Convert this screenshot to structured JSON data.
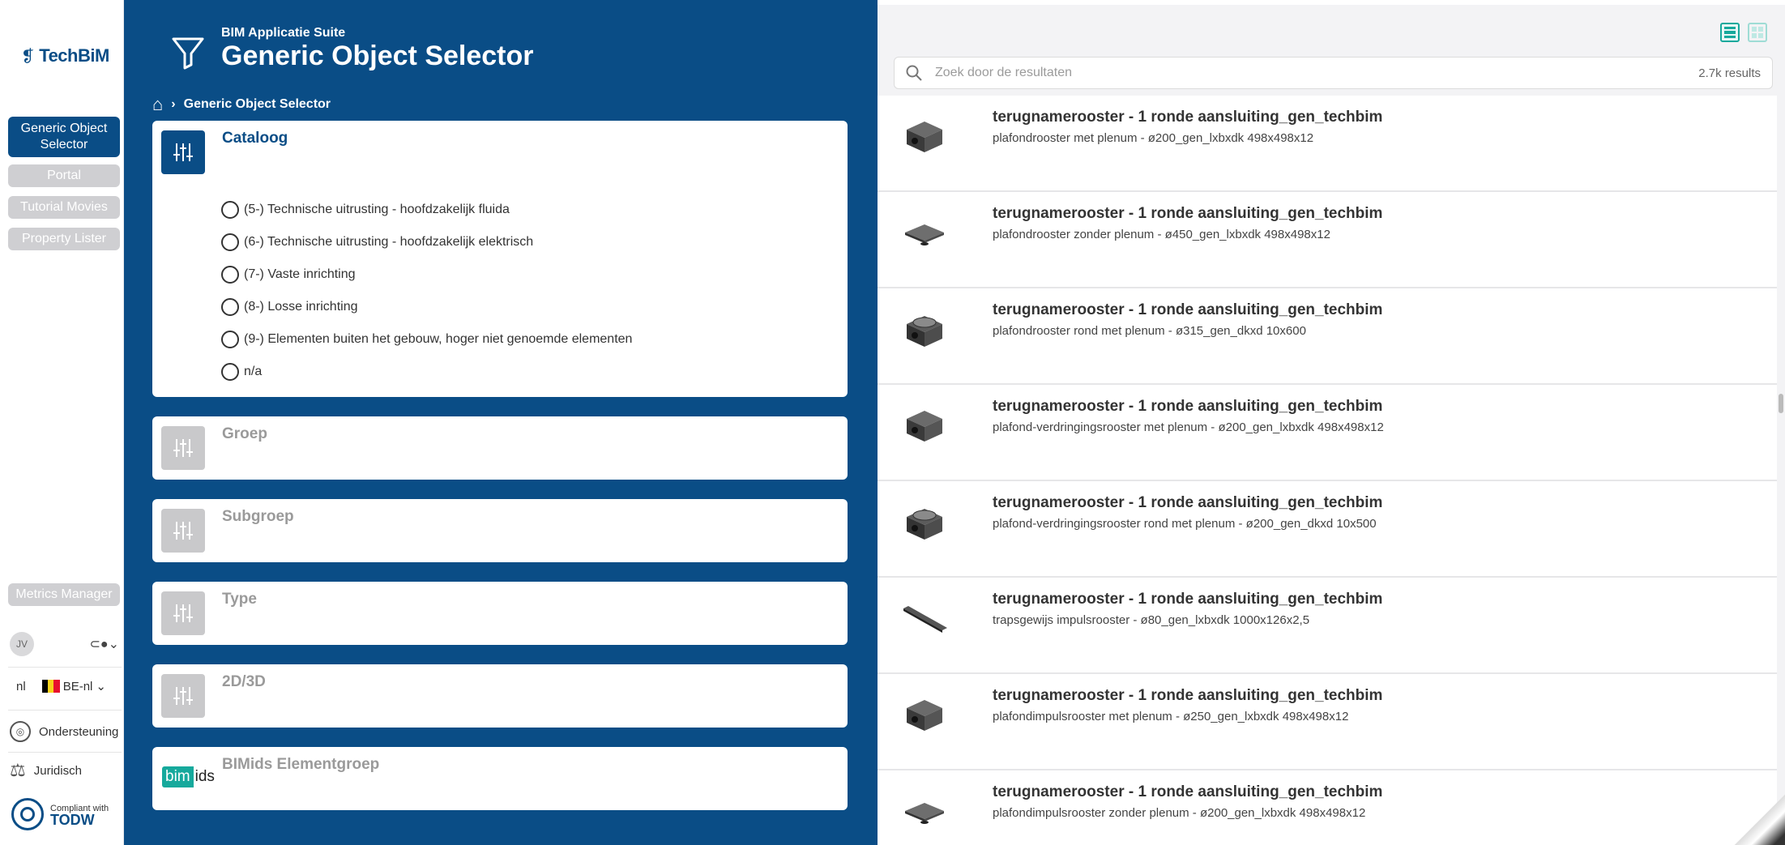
{
  "brand": {
    "name": "TechBiM",
    "logo_glyph": "❡"
  },
  "nav": {
    "items": [
      {
        "label": "Generic Object Selector",
        "active": true
      },
      {
        "label": "Portal",
        "active": false
      },
      {
        "label": "Tutorial Movies",
        "active": false
      },
      {
        "label": "Property Lister",
        "active": false
      }
    ],
    "metrics_label": "Metrics Manager"
  },
  "user": {
    "initials": "JV"
  },
  "locale": {
    "lang": "nl",
    "region": "BE-nl"
  },
  "footer_links": {
    "support": "Ondersteuning",
    "legal": "Juridisch"
  },
  "compliance": {
    "small": "Compliant with",
    "big": "TODW"
  },
  "header": {
    "suite": "BIM Applicatie Suite",
    "title": "Generic Object Selector"
  },
  "breadcrumb": {
    "current": "Generic Object Selector"
  },
  "filters": {
    "catalog": {
      "title": "Cataloog",
      "options": [
        "(5-) Technische uitrusting - hoofdzakelijk fluida",
        "(6-) Technische uitrusting - hoofdzakelijk elektrisch",
        "(7-) Vaste inrichting",
        "(8-) Losse inrichting",
        "(9-) Elementen buiten het gebouw, hoger niet genoemde elementen",
        "n/a"
      ]
    },
    "group": {
      "title": "Groep"
    },
    "subgroup": {
      "title": "Subgroep"
    },
    "type": {
      "title": "Type"
    },
    "dims": {
      "title": "2D/3D"
    },
    "bimids": {
      "title": "BIMids Elementgroep",
      "logo_b": "bim",
      "logo_i": "ids"
    }
  },
  "search": {
    "placeholder": "Zoek door de resultaten",
    "count": "2.7k results"
  },
  "results": [
    {
      "title": "terugnamerooster - 1 ronde aansluiting_gen_techbim",
      "subtitle": "plafondrooster met plenum - ø200_gen_lxbxdk 498x498x12",
      "thumb": "box"
    },
    {
      "title": "terugnamerooster - 1 ronde aansluiting_gen_techbim",
      "subtitle": "plafondrooster zonder plenum - ø450_gen_lxbxdk 498x498x12",
      "thumb": "flat"
    },
    {
      "title": "terugnamerooster - 1 ronde aansluiting_gen_techbim",
      "subtitle": "plafondrooster rond met plenum - ø315_gen_dkxd 10x600",
      "thumb": "round"
    },
    {
      "title": "terugnamerooster - 1 ronde aansluiting_gen_techbim",
      "subtitle": "plafond-verdringingsrooster met plenum - ø200_gen_lxbxdk 498x498x12",
      "thumb": "box"
    },
    {
      "title": "terugnamerooster - 1 ronde aansluiting_gen_techbim",
      "subtitle": "plafond-verdringingsrooster rond met plenum - ø200_gen_dkxd 10x500",
      "thumb": "round"
    },
    {
      "title": "terugnamerooster - 1 ronde aansluiting_gen_techbim",
      "subtitle": "trapsgewijs impulsrooster - ø80_gen_lxbxdk 1000x126x2,5",
      "thumb": "bar"
    },
    {
      "title": "terugnamerooster - 1 ronde aansluiting_gen_techbim",
      "subtitle": "plafondimpulsrooster met plenum - ø250_gen_lxbxdk 498x498x12",
      "thumb": "box"
    },
    {
      "title": "terugnamerooster - 1 ronde aansluiting_gen_techbim",
      "subtitle": "plafondimpulsrooster zonder plenum - ø200_gen_lxbxdk 498x498x12",
      "thumb": "flat"
    }
  ],
  "colors": {
    "primary": "#0a4d86",
    "accent": "#16a99c",
    "muted": "#cfcfd2"
  }
}
